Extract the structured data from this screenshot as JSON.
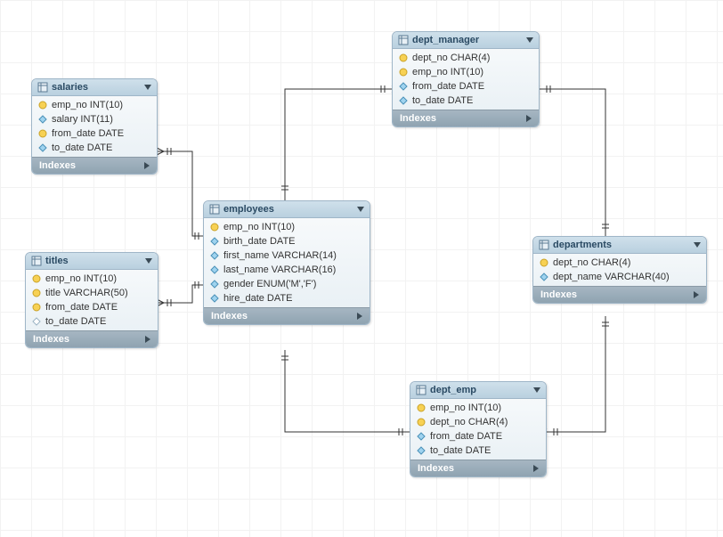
{
  "diagram": {
    "type": "entity-relationship",
    "tool": "MySQL Workbench style"
  },
  "entities": {
    "salaries": {
      "title": "salaries",
      "columns": [
        {
          "icon": "pk",
          "label": "emp_no INT(10)"
        },
        {
          "icon": "attr",
          "label": "salary INT(11)"
        },
        {
          "icon": "pk",
          "label": "from_date DATE"
        },
        {
          "icon": "attr",
          "label": "to_date DATE"
        }
      ],
      "indexes_label": "Indexes"
    },
    "titles": {
      "title": "titles",
      "columns": [
        {
          "icon": "pk",
          "label": "emp_no INT(10)"
        },
        {
          "icon": "pk",
          "label": "title VARCHAR(50)"
        },
        {
          "icon": "pk",
          "label": "from_date DATE"
        },
        {
          "icon": "null",
          "label": "to_date DATE"
        }
      ],
      "indexes_label": "Indexes"
    },
    "employees": {
      "title": "employees",
      "columns": [
        {
          "icon": "pk",
          "label": "emp_no INT(10)"
        },
        {
          "icon": "attr",
          "label": "birth_date DATE"
        },
        {
          "icon": "attr",
          "label": "first_name VARCHAR(14)"
        },
        {
          "icon": "attr",
          "label": "last_name VARCHAR(16)"
        },
        {
          "icon": "attr",
          "label": "gender ENUM('M','F')"
        },
        {
          "icon": "attr",
          "label": "hire_date DATE"
        }
      ],
      "indexes_label": "Indexes"
    },
    "dept_manager": {
      "title": "dept_manager",
      "columns": [
        {
          "icon": "pk",
          "label": "dept_no CHAR(4)"
        },
        {
          "icon": "pk",
          "label": "emp_no INT(10)"
        },
        {
          "icon": "attr",
          "label": "from_date DATE"
        },
        {
          "icon": "attr",
          "label": "to_date DATE"
        }
      ],
      "indexes_label": "Indexes"
    },
    "dept_emp": {
      "title": "dept_emp",
      "columns": [
        {
          "icon": "pk",
          "label": "emp_no INT(10)"
        },
        {
          "icon": "pk",
          "label": "dept_no CHAR(4)"
        },
        {
          "icon": "attr",
          "label": "from_date DATE"
        },
        {
          "icon": "attr",
          "label": "to_date DATE"
        }
      ],
      "indexes_label": "Indexes"
    },
    "departments": {
      "title": "departments",
      "columns": [
        {
          "icon": "pk",
          "label": "dept_no CHAR(4)"
        },
        {
          "icon": "attr",
          "label": "dept_name VARCHAR(40)"
        }
      ],
      "indexes_label": "Indexes"
    }
  },
  "relationships": [
    {
      "from": "salaries",
      "to": "employees",
      "type": "identifying",
      "cardinality": "many-to-one"
    },
    {
      "from": "titles",
      "to": "employees",
      "type": "identifying",
      "cardinality": "many-to-one"
    },
    {
      "from": "dept_manager",
      "to": "employees",
      "type": "identifying",
      "cardinality": "many-to-one"
    },
    {
      "from": "dept_emp",
      "to": "employees",
      "type": "identifying",
      "cardinality": "many-to-one"
    },
    {
      "from": "dept_manager",
      "to": "departments",
      "type": "identifying",
      "cardinality": "many-to-one"
    },
    {
      "from": "dept_emp",
      "to": "departments",
      "type": "identifying",
      "cardinality": "many-to-one"
    }
  ]
}
